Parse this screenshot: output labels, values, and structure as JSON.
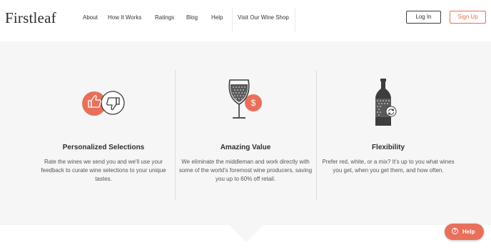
{
  "header": {
    "logo": "Firstleaf",
    "nav": [
      "About",
      "How It Works",
      "Ratings",
      "Blog",
      "Help",
      "Visit Our Wine Shop"
    ],
    "login_label": "Log In",
    "signup_label": "Sign Up"
  },
  "features": [
    {
      "icon": "thumbs-up-down-icon",
      "title": "Personalized Selections",
      "text": "Rate the wines we send you and we'll use your feedback to curate wine selections to your unique tastes."
    },
    {
      "icon": "wine-glass-dollar-icon",
      "title": "Amazing Value",
      "text": "We eliminate the middleman and work directly with some of the world's foremost wine producers, saving you up to 60% off retail."
    },
    {
      "icon": "wine-bottle-refresh-icon",
      "title": "Flexibility",
      "text": "Prefer red, white, or a mix? It's up to you what wines you get, when you get them, and how often."
    }
  ],
  "help_button": {
    "label": "Help"
  },
  "colors": {
    "accent": "#e8705b",
    "band": "#f6f6f6",
    "icon_dark": "#3d3d3d"
  }
}
